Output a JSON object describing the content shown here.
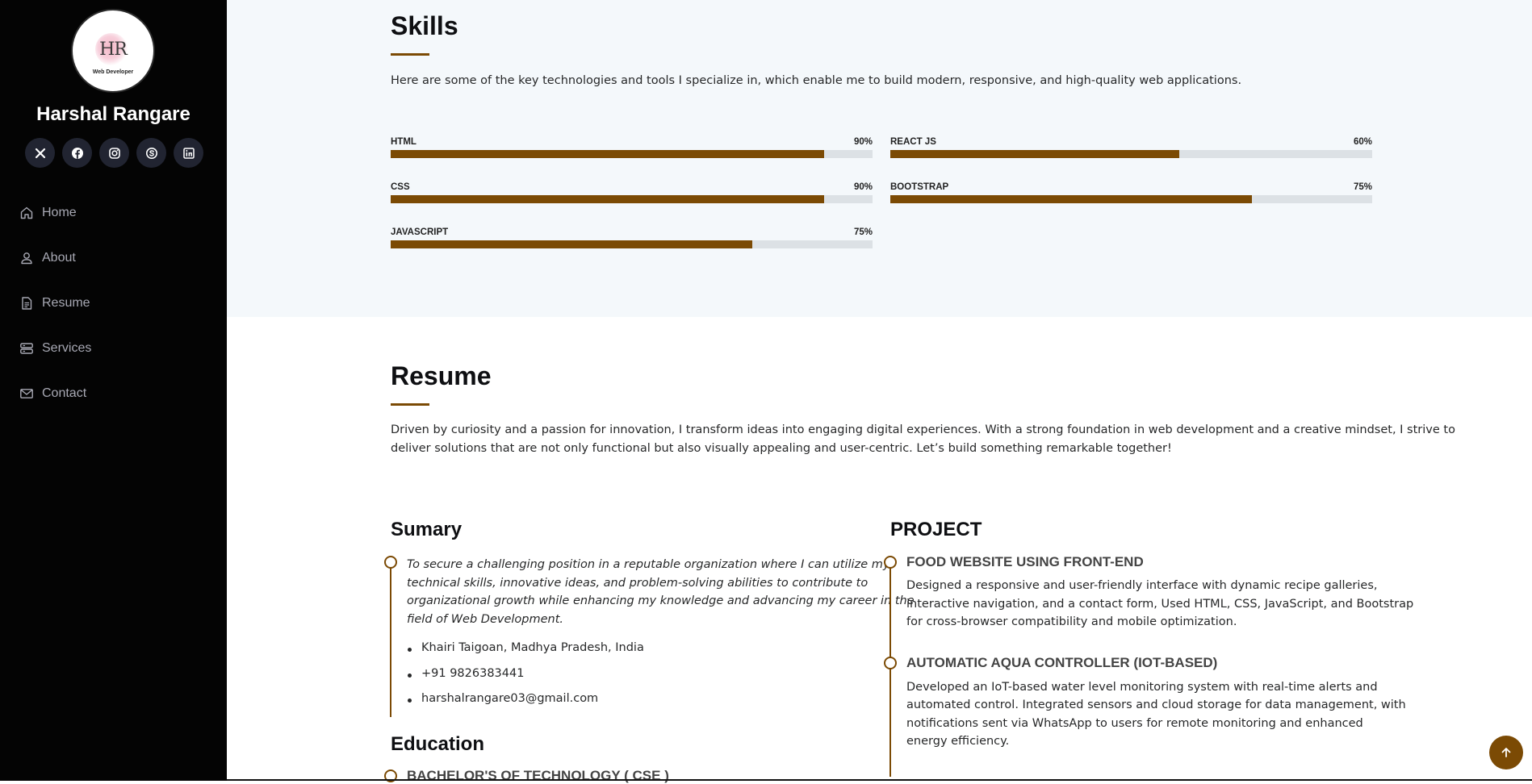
{
  "sidebar": {
    "avatar": {
      "monogram": "HR",
      "tagline": "Web Developer"
    },
    "name": "Harshal Rangare",
    "socials": [
      {
        "icon": "x-twitter-icon"
      },
      {
        "icon": "facebook-icon"
      },
      {
        "icon": "instagram-icon"
      },
      {
        "icon": "skype-icon"
      },
      {
        "icon": "linkedin-icon"
      }
    ],
    "nav": [
      {
        "label": "Home",
        "icon": "house-icon"
      },
      {
        "label": "About",
        "icon": "person-icon"
      },
      {
        "label": "Resume",
        "icon": "file-icon"
      },
      {
        "label": "Services",
        "icon": "server-icon"
      },
      {
        "label": "Contact",
        "icon": "envelope-icon"
      }
    ]
  },
  "skills": {
    "title": "Skills",
    "description": "Here are some of the key technologies and tools I specialize in, which enable me to build modern, responsive, and high-quality web applications.",
    "items": [
      {
        "name": "HTML",
        "percent_label": "90%",
        "value": 90
      },
      {
        "name": "REACT JS",
        "percent_label": "60%",
        "value": 60
      },
      {
        "name": "CSS",
        "percent_label": "90%",
        "value": 90
      },
      {
        "name": "BOOTSTRAP",
        "percent_label": "75%",
        "value": 75
      },
      {
        "name": "JAVASCRIPT",
        "percent_label": "75%",
        "value": 75
      }
    ]
  },
  "resume": {
    "title": "Resume",
    "description_line1": "Driven by curiosity and a passion for innovation, I transform ideas into engaging digital experiences. With a strong foundation in web development and a creative mindset, I strive to",
    "description_line2": "deliver solutions that are not only functional but also visually appealing and user-centric. Let’s build something remarkable together!",
    "summary": {
      "title": "Sumary",
      "lines": [
        "To secure a challenging position in a reputable organization where I can utilize my",
        "technical skills, innovative ideas, and problem-solving abilities to contribute to",
        "organizational growth while enhancing my knowledge and advancing my career in the",
        "field of Web Development."
      ],
      "contacts": [
        "Khairi Taigoan, Madhya Pradesh, India",
        "+91 9826383441",
        "harshalrangare03@gmail.com"
      ]
    },
    "education": {
      "title": "Education",
      "first_item": "BACHELOR'S OF TECHNOLOGY ( CSE )"
    },
    "project": {
      "title": "PROJECT",
      "items": [
        {
          "title": "FOOD WEBSITE USING FRONT-END",
          "lines": [
            "Designed a responsive and user-friendly interface with dynamic recipe galleries,",
            "interactive navigation, and a contact form, Used HTML, CSS, JavaScript, and Bootstrap",
            "for cross-browser compatibility and mobile optimization."
          ]
        },
        {
          "title": "AUTOMATIC AQUA CONTROLLER (IOT-BASED)",
          "lines": [
            "Developed an IoT-based water level monitoring system with real-time alerts and",
            "automated control. Integrated sensors and cloud storage for data management, with",
            "notifications sent via WhatsApp to users for remote monitoring and enhanced",
            "energy efficiency."
          ]
        }
      ]
    }
  },
  "colors": {
    "accent": "#7b4a04",
    "sidebar": "#040404",
    "nav_text": "#a8a9b4"
  }
}
